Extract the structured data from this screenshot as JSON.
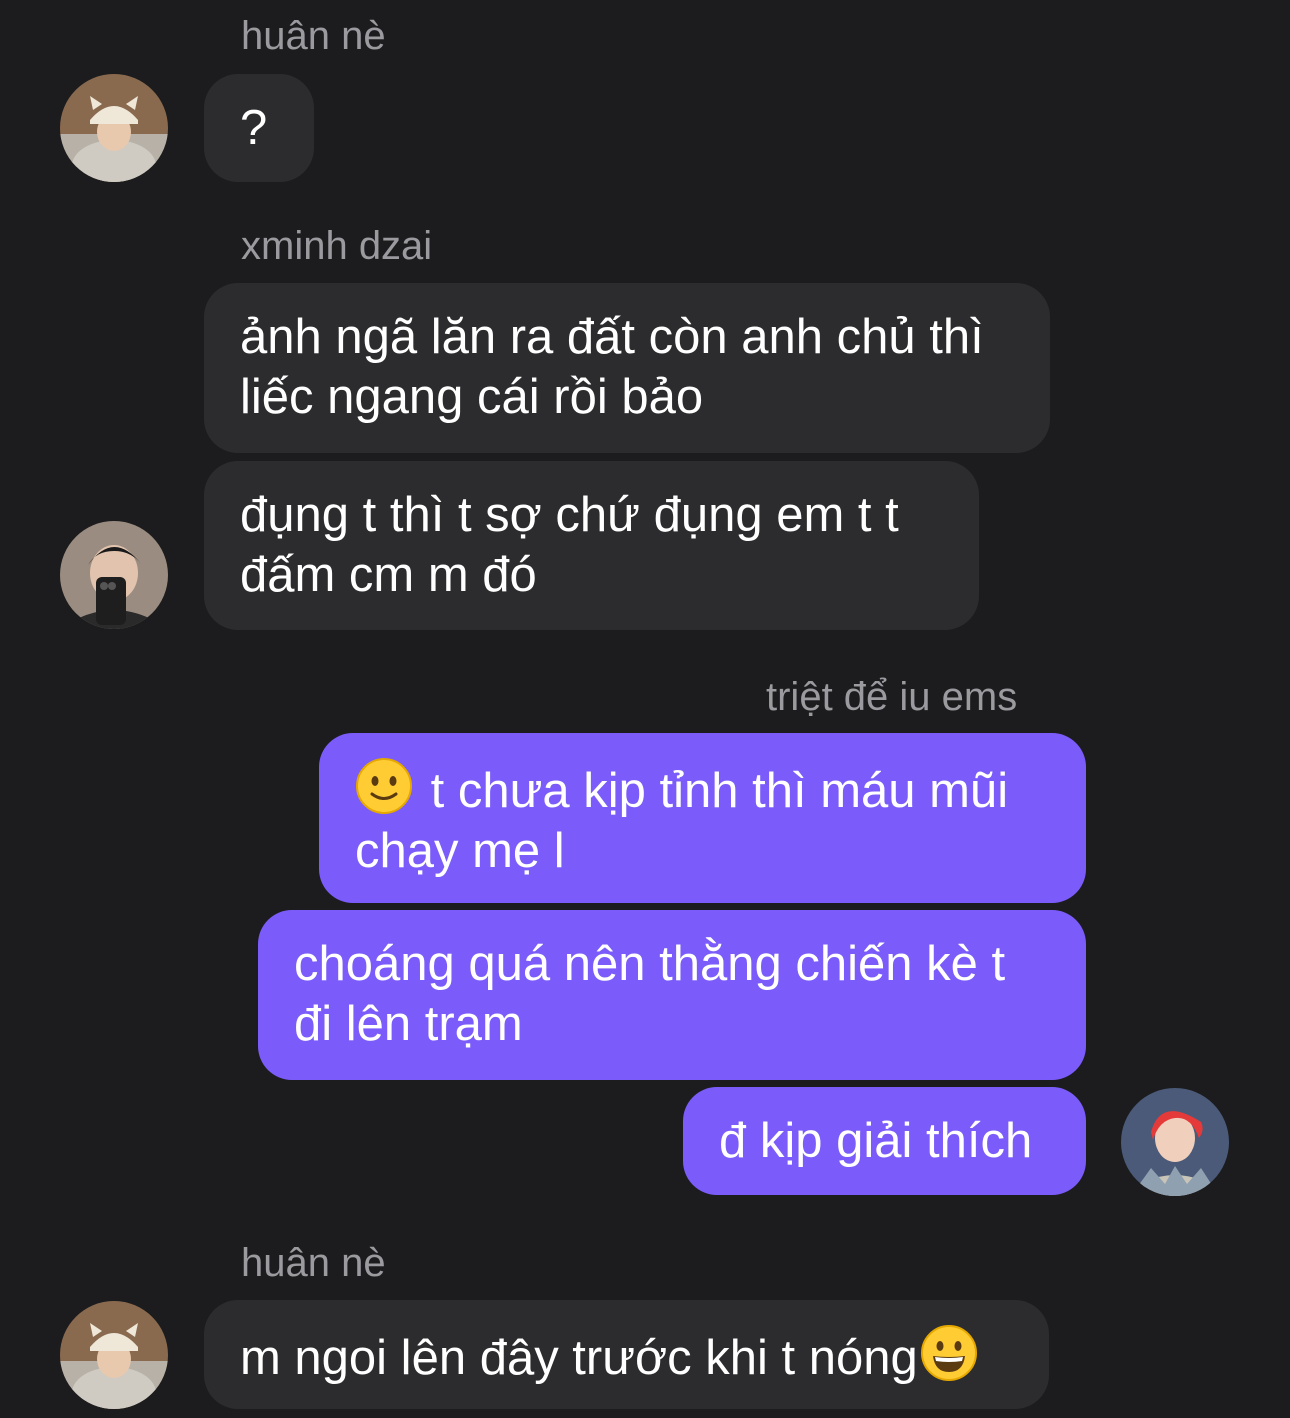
{
  "messages": [
    {
      "sender": "huân nè",
      "text": "?"
    },
    {
      "sender": "xminh dzai",
      "text": "ảnh ngã lăn ra đất còn anh chủ thì liếc ngang cái rồi bảo"
    },
    {
      "text": "đụng t thì t sợ chứ đụng em t t đấm cm m đó"
    },
    {
      "sender": "triệt để iu ems",
      "text": "t chưa kịp tỉnh thì máu mũi chạy mẹ l",
      "emoji": "slightly-smiling-face-emoji"
    },
    {
      "text": "choáng quá nên thằng chiến kè t đi lên trạm"
    },
    {
      "text": "đ kịp giải thích"
    },
    {
      "sender": "huân nè",
      "text": "m ngoi lên đây trước khi t nóng",
      "emoji": "grinning-face-emoji"
    }
  ],
  "colors": {
    "background": "#1c1c1e",
    "incoming_bubble": "#2c2c2e",
    "outgoing_bubble": "#7b5cfa",
    "sender_name": "#9a9a9f",
    "text": "#ffffff"
  },
  "avatars": [
    "huan-ne-avatar",
    "xminh-dzai-avatar",
    "triet-de-iu-ems-avatar"
  ]
}
